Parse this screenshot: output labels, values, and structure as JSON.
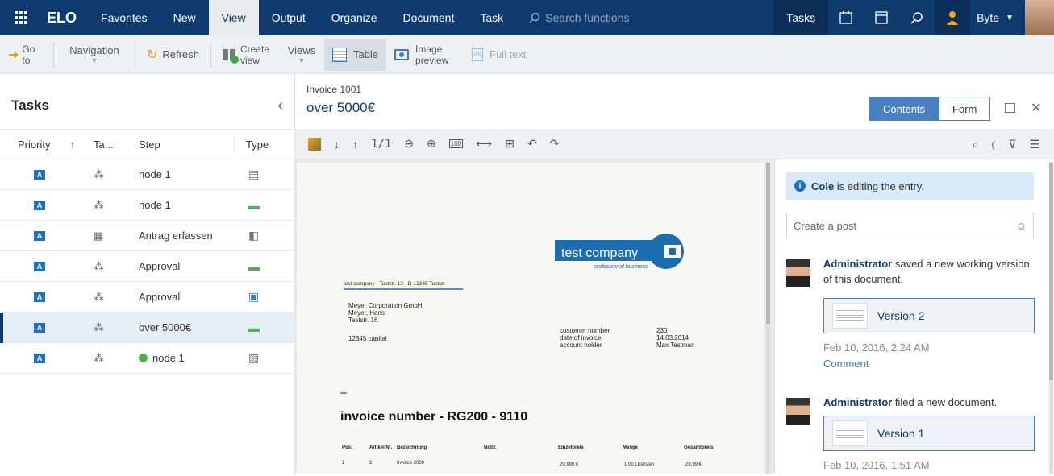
{
  "topbar": {
    "logo": "ELO",
    "menu": [
      "Favorites",
      "New",
      "View",
      "Output",
      "Organize",
      "Document",
      "Task"
    ],
    "active_menu": "View",
    "search_placeholder": "Search functions",
    "tasks_label": "Tasks",
    "user_label": "Byte",
    "icons": [
      "grid-icon",
      "elo-icon",
      "window-icon",
      "search-icon",
      "user-icon"
    ]
  },
  "toolbar": {
    "goto": "Go to",
    "navigation": "Navigation",
    "refresh": "Refresh",
    "create_view": "Create view",
    "views": "Views",
    "table": "Table",
    "image_preview": "Image preview",
    "full_text": "Full text"
  },
  "tasks_panel": {
    "title": "Tasks",
    "columns": [
      "Priority",
      "Ta...",
      "Step",
      "Type"
    ],
    "rows": [
      {
        "priority": "A",
        "step": "node 1",
        "selected": false,
        "dot": false
      },
      {
        "priority": "A",
        "step": "node 1",
        "selected": false,
        "dot": false
      },
      {
        "priority": "A",
        "step": "Antrag erfassen",
        "selected": false,
        "dot": false
      },
      {
        "priority": "A",
        "step": "Approval",
        "selected": false,
        "dot": false
      },
      {
        "priority": "A",
        "step": "Approval",
        "selected": false,
        "dot": false
      },
      {
        "priority": "A",
        "step": "over 5000€",
        "selected": true,
        "dot": false
      },
      {
        "priority": "A",
        "step": "node 1",
        "selected": false,
        "dot": true
      }
    ]
  },
  "document": {
    "subtitle": "Invoice 1001",
    "title": "over 5000€",
    "page_indicator": "1/1",
    "company_logo": "test company",
    "company_tagline": "professional business",
    "sender_line": "test company - Teststr. 12 - D-12345 Testort",
    "recipient": [
      "Meyer Corporation GmbH",
      "Meyer, Hans",
      "Teststr. 16",
      "12345 capital"
    ],
    "meta_labels": [
      "customer number",
      "date of invoice",
      "account holder"
    ],
    "meta_values": [
      "230",
      "14.03.2014",
      "Max Testman"
    ],
    "invoice_number": "invoice number - RG200 - 9110",
    "table_headers": [
      "Pos:",
      "Artikel Nr.",
      "Bezeichnung",
      "Notiz",
      "Einzelpreis",
      "Menge",
      "Gesamtpreis"
    ],
    "table_row": [
      "1",
      "2",
      "Invoice 2009",
      "",
      "29,990 €",
      "1.00 Lizenzen",
      "29.99 €"
    ]
  },
  "right_panel": {
    "tabs": [
      "Contents",
      "Form"
    ],
    "active_tab": "Contents",
    "info_user": "Cole",
    "info_text": " is editing the entry.",
    "post_placeholder": "Create a post",
    "entries": [
      {
        "user": "Administrator",
        "text": " saved a new working version of this document.",
        "version": "Version 2",
        "date": "Feb 10, 2016, 2:24 AM",
        "comment": "Comment"
      },
      {
        "user": "Administrator",
        "text": " filed a new document.",
        "version": "Version 1",
        "date": "Feb 10, 2016, 1:51 AM",
        "comment": ""
      }
    ]
  },
  "colors": {
    "brand": "#0f3a6e",
    "accent": "#4a7fc1",
    "priority": "#1f6fc8"
  }
}
